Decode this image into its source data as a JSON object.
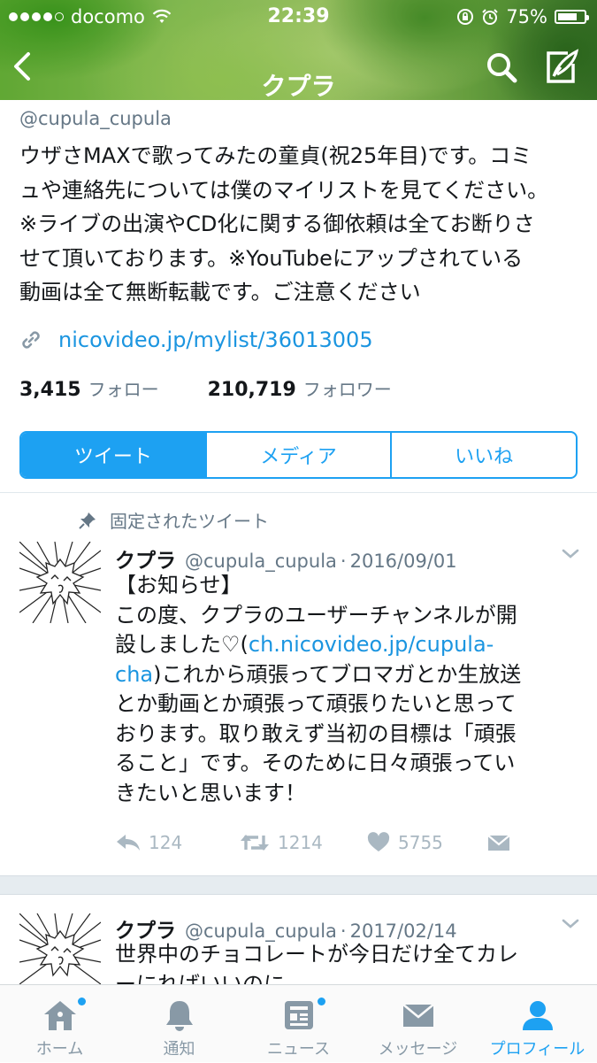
{
  "status_bar": {
    "carrier": "docomo",
    "time": "22:39",
    "battery": "75%",
    "battery_level": 0.75
  },
  "nav": {
    "title": "クプラ",
    "back_icon": "back-arrow-icon",
    "search_icon": "search-icon",
    "compose_icon": "compose-tweet-icon"
  },
  "profile": {
    "handle": "@cupula_cupula",
    "bio": "ウザさMAXで歌ってみたの童貞(祝25年目)です。コミ\nュや連絡先については僕のマイリストを見てください。\n※ライブの出演やCD化に関する御依頼は全てお断りさ\nせて頂いております。※YouTubeにアップされている\n動画は全て無断転載です。ご注意ください",
    "link": "nicovideo.jp/mylist/36013005",
    "following_count": "3,415",
    "following_label": "フォロー",
    "followers_count": "210,719",
    "followers_label": "フォロワー"
  },
  "tabs": [
    {
      "label": "ツイート",
      "active": true
    },
    {
      "label": "メディア",
      "active": false
    },
    {
      "label": "いいね",
      "active": false
    }
  ],
  "pinned_label": "固定されたツイート",
  "tweets": [
    {
      "name": "クプラ",
      "handle": "@cupula_cupula",
      "sep": "·",
      "date": "2016/09/01",
      "body_part1": "【お知らせ】\nこの度、クプラのユーザーチャンネルが開\n設しました♡(",
      "body_link1": "ch.nicovideo.jp/cupula-",
      "body_link2": "cha",
      "body_part2": ")これから頑張ってブロマガとか生放送\nとか動画とか頑張って頑張りたいと思って\nおります。取り敢えず当初の目標は「頑張\nること」です。そのために日々頑張ってい\nきたいと思います！",
      "replies": "124",
      "retweets": "1214",
      "likes": "5755"
    },
    {
      "name": "クプラ",
      "handle": "@cupula_cupula",
      "sep": "·",
      "date": "2017/02/14",
      "body": "世界中のチョコレートが今日だけ全てカレ\nーにればいいのに"
    }
  ],
  "tabbar": [
    {
      "label": "ホーム",
      "icon": "home-icon",
      "active": false,
      "badge": true
    },
    {
      "label": "通知",
      "icon": "bell-icon",
      "active": false,
      "badge": false
    },
    {
      "label": "ニュース",
      "icon": "news-icon",
      "active": false,
      "badge": true
    },
    {
      "label": "メッセージ",
      "icon": "envelope-icon",
      "active": false,
      "badge": false
    },
    {
      "label": "プロフィール",
      "icon": "person-icon",
      "active": true,
      "badge": false
    }
  ],
  "colors": {
    "accent": "#1da1f2",
    "link": "#1b95e0",
    "muted": "#657786",
    "icon_gray": "#aab8c2"
  }
}
